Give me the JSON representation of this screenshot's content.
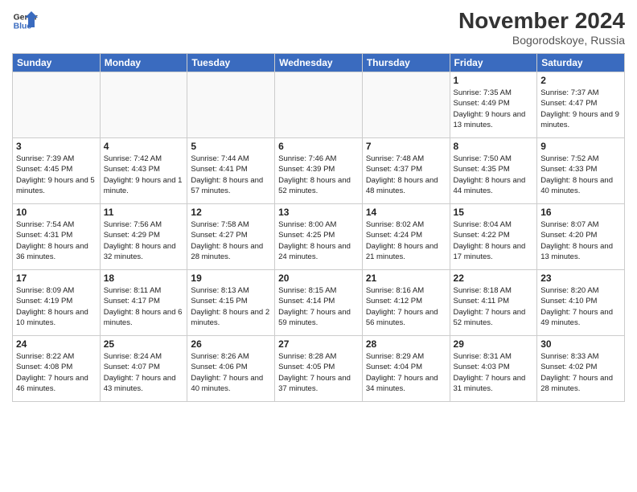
{
  "header": {
    "logo_line1": "General",
    "logo_line2": "Blue",
    "month": "November 2024",
    "location": "Bogorodskoye, Russia"
  },
  "weekdays": [
    "Sunday",
    "Monday",
    "Tuesday",
    "Wednesday",
    "Thursday",
    "Friday",
    "Saturday"
  ],
  "weeks": [
    [
      {
        "day": "",
        "info": ""
      },
      {
        "day": "",
        "info": ""
      },
      {
        "day": "",
        "info": ""
      },
      {
        "day": "",
        "info": ""
      },
      {
        "day": "",
        "info": ""
      },
      {
        "day": "1",
        "info": "Sunrise: 7:35 AM\nSunset: 4:49 PM\nDaylight: 9 hours and 13 minutes."
      },
      {
        "day": "2",
        "info": "Sunrise: 7:37 AM\nSunset: 4:47 PM\nDaylight: 9 hours and 9 minutes."
      }
    ],
    [
      {
        "day": "3",
        "info": "Sunrise: 7:39 AM\nSunset: 4:45 PM\nDaylight: 9 hours and 5 minutes."
      },
      {
        "day": "4",
        "info": "Sunrise: 7:42 AM\nSunset: 4:43 PM\nDaylight: 9 hours and 1 minute."
      },
      {
        "day": "5",
        "info": "Sunrise: 7:44 AM\nSunset: 4:41 PM\nDaylight: 8 hours and 57 minutes."
      },
      {
        "day": "6",
        "info": "Sunrise: 7:46 AM\nSunset: 4:39 PM\nDaylight: 8 hours and 52 minutes."
      },
      {
        "day": "7",
        "info": "Sunrise: 7:48 AM\nSunset: 4:37 PM\nDaylight: 8 hours and 48 minutes."
      },
      {
        "day": "8",
        "info": "Sunrise: 7:50 AM\nSunset: 4:35 PM\nDaylight: 8 hours and 44 minutes."
      },
      {
        "day": "9",
        "info": "Sunrise: 7:52 AM\nSunset: 4:33 PM\nDaylight: 8 hours and 40 minutes."
      }
    ],
    [
      {
        "day": "10",
        "info": "Sunrise: 7:54 AM\nSunset: 4:31 PM\nDaylight: 8 hours and 36 minutes."
      },
      {
        "day": "11",
        "info": "Sunrise: 7:56 AM\nSunset: 4:29 PM\nDaylight: 8 hours and 32 minutes."
      },
      {
        "day": "12",
        "info": "Sunrise: 7:58 AM\nSunset: 4:27 PM\nDaylight: 8 hours and 28 minutes."
      },
      {
        "day": "13",
        "info": "Sunrise: 8:00 AM\nSunset: 4:25 PM\nDaylight: 8 hours and 24 minutes."
      },
      {
        "day": "14",
        "info": "Sunrise: 8:02 AM\nSunset: 4:24 PM\nDaylight: 8 hours and 21 minutes."
      },
      {
        "day": "15",
        "info": "Sunrise: 8:04 AM\nSunset: 4:22 PM\nDaylight: 8 hours and 17 minutes."
      },
      {
        "day": "16",
        "info": "Sunrise: 8:07 AM\nSunset: 4:20 PM\nDaylight: 8 hours and 13 minutes."
      }
    ],
    [
      {
        "day": "17",
        "info": "Sunrise: 8:09 AM\nSunset: 4:19 PM\nDaylight: 8 hours and 10 minutes."
      },
      {
        "day": "18",
        "info": "Sunrise: 8:11 AM\nSunset: 4:17 PM\nDaylight: 8 hours and 6 minutes."
      },
      {
        "day": "19",
        "info": "Sunrise: 8:13 AM\nSunset: 4:15 PM\nDaylight: 8 hours and 2 minutes."
      },
      {
        "day": "20",
        "info": "Sunrise: 8:15 AM\nSunset: 4:14 PM\nDaylight: 7 hours and 59 minutes."
      },
      {
        "day": "21",
        "info": "Sunrise: 8:16 AM\nSunset: 4:12 PM\nDaylight: 7 hours and 56 minutes."
      },
      {
        "day": "22",
        "info": "Sunrise: 8:18 AM\nSunset: 4:11 PM\nDaylight: 7 hours and 52 minutes."
      },
      {
        "day": "23",
        "info": "Sunrise: 8:20 AM\nSunset: 4:10 PM\nDaylight: 7 hours and 49 minutes."
      }
    ],
    [
      {
        "day": "24",
        "info": "Sunrise: 8:22 AM\nSunset: 4:08 PM\nDaylight: 7 hours and 46 minutes."
      },
      {
        "day": "25",
        "info": "Sunrise: 8:24 AM\nSunset: 4:07 PM\nDaylight: 7 hours and 43 minutes."
      },
      {
        "day": "26",
        "info": "Sunrise: 8:26 AM\nSunset: 4:06 PM\nDaylight: 7 hours and 40 minutes."
      },
      {
        "day": "27",
        "info": "Sunrise: 8:28 AM\nSunset: 4:05 PM\nDaylight: 7 hours and 37 minutes."
      },
      {
        "day": "28",
        "info": "Sunrise: 8:29 AM\nSunset: 4:04 PM\nDaylight: 7 hours and 34 minutes."
      },
      {
        "day": "29",
        "info": "Sunrise: 8:31 AM\nSunset: 4:03 PM\nDaylight: 7 hours and 31 minutes."
      },
      {
        "day": "30",
        "info": "Sunrise: 8:33 AM\nSunset: 4:02 PM\nDaylight: 7 hours and 28 minutes."
      }
    ]
  ]
}
